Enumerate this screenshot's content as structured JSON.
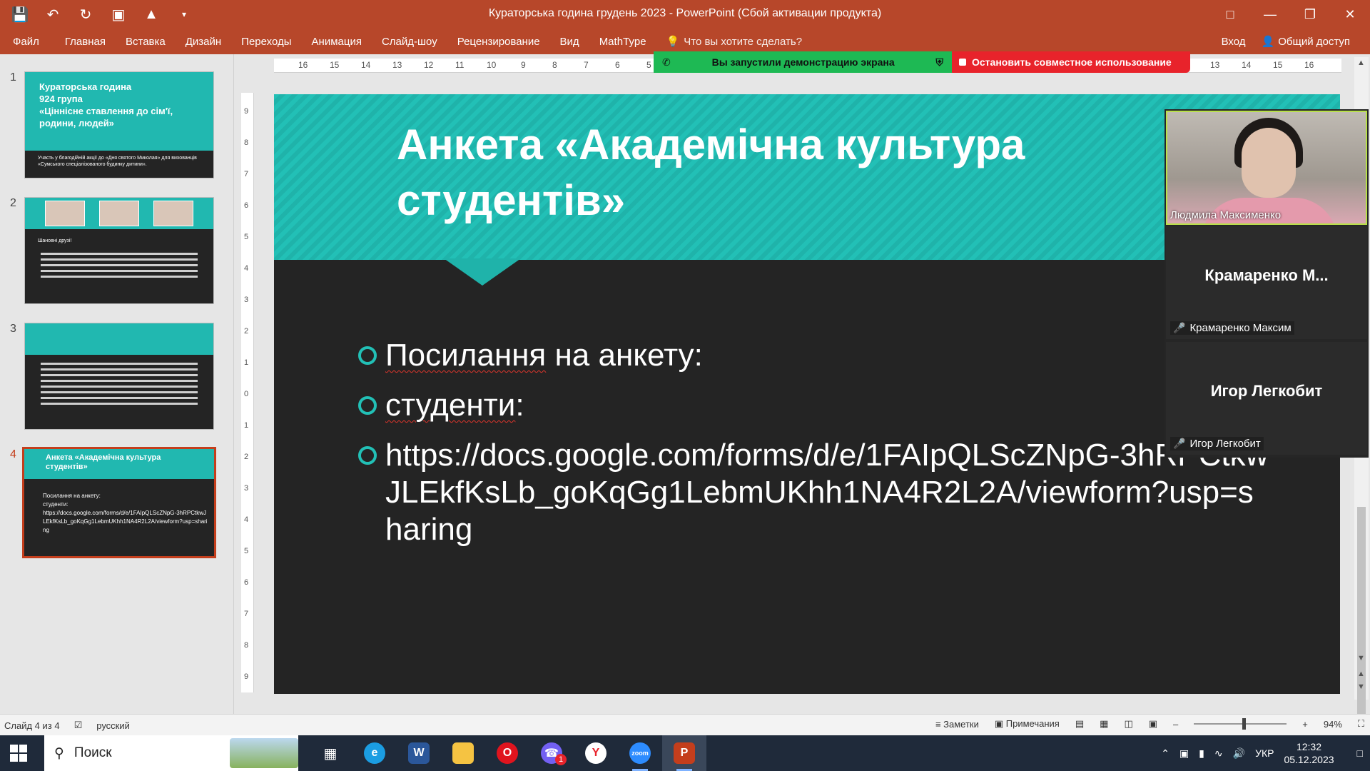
{
  "window": {
    "title": "Кураторська година грудень 2023 - PowerPoint (Сбой активации продукта)",
    "controls": [
      "restore-ribbon",
      "minimize",
      "maximize",
      "close"
    ]
  },
  "ribbon": {
    "tabs": [
      "Файл",
      "Главная",
      "Вставка",
      "Дизайн",
      "Переходы",
      "Анимация",
      "Слайд-шоу",
      "Рецензирование",
      "Вид",
      "MathType"
    ],
    "tell_me": "Что вы хотите сделать?",
    "signin": "Вход",
    "share": "Общий доступ"
  },
  "screen_share": {
    "status": "Вы запустили демонстрацию экрана",
    "stop": "Остановить совместное использование",
    "status_color": "#1eb954",
    "stop_color": "#e8232b"
  },
  "ruler": {
    "h_ticks": [
      "16",
      "15",
      "14",
      "13",
      "12",
      "11",
      "10",
      "9",
      "8",
      "7",
      "6",
      "5",
      "13",
      "14",
      "15",
      "16"
    ],
    "v_ticks": [
      "9",
      "8",
      "7",
      "6",
      "5",
      "4",
      "3",
      "2",
      "1",
      "0",
      "1",
      "2",
      "3",
      "4",
      "5",
      "6",
      "7",
      "8",
      "9"
    ]
  },
  "thumbnails": [
    {
      "num": "1",
      "title": "Кураторська година\n924 група\n«Ціннісне ставлення до сім'ї, родини, людей»",
      "body": "Участь у благодійній акції до «Дня святого Миколая» для вихованців «Сумського спеціалізованого будинку дитини»."
    },
    {
      "num": "2",
      "title": "",
      "body": "Шановні друзі!"
    },
    {
      "num": "3",
      "title": "",
      "body": ""
    },
    {
      "num": "4",
      "title": "Анкета «Академічна культура студентів»",
      "body": "Посилання на анкету:\nстуденти:\nhttps://docs.google.com/forms/d/e/1FAIpQLScZNpG-3hRPCtkwJLEkfKsLb_goKqGg1LebmUKhh1NA4R2L2A/viewform?usp=sharing"
    }
  ],
  "slide": {
    "title": "Анкета «Академічна культура студентів»",
    "bullets": [
      {
        "text_a": "Посилання",
        "text_b": " на анкету:"
      },
      {
        "text_a": "студенти",
        "text_b": ":"
      },
      {
        "text_a": "https://docs.google.com/forms/d/e/1FAIpQLScZNpG-3hRPCtkwJLEkfKsLb_goKqGg1LebmUKhh1NA4R2L2A/viewform?usp=sharing",
        "text_b": ""
      }
    ],
    "accent": "#22c0b6"
  },
  "participants": [
    {
      "name": "Людмила Максименко",
      "big": "",
      "video": true
    },
    {
      "name": "Крамаренко Максим",
      "big": "Крамаренко  М...",
      "video": false
    },
    {
      "name": "Игор Легкобит",
      "big": "Игор Легкобит",
      "video": false
    }
  ],
  "statusbar": {
    "slide": "Слайд 4 из 4",
    "language": "русский",
    "notes": "Заметки",
    "comments": "Примечания",
    "zoom": "94%"
  },
  "taskbar": {
    "search": "Поиск",
    "apps": [
      "task-view",
      "edge",
      "word",
      "explorer",
      "opera",
      "viber",
      "yandex",
      "zoom",
      "powerpoint"
    ],
    "viber_badge": "1",
    "language": "УКР",
    "time": "12:32",
    "date": "05.12.2023"
  }
}
